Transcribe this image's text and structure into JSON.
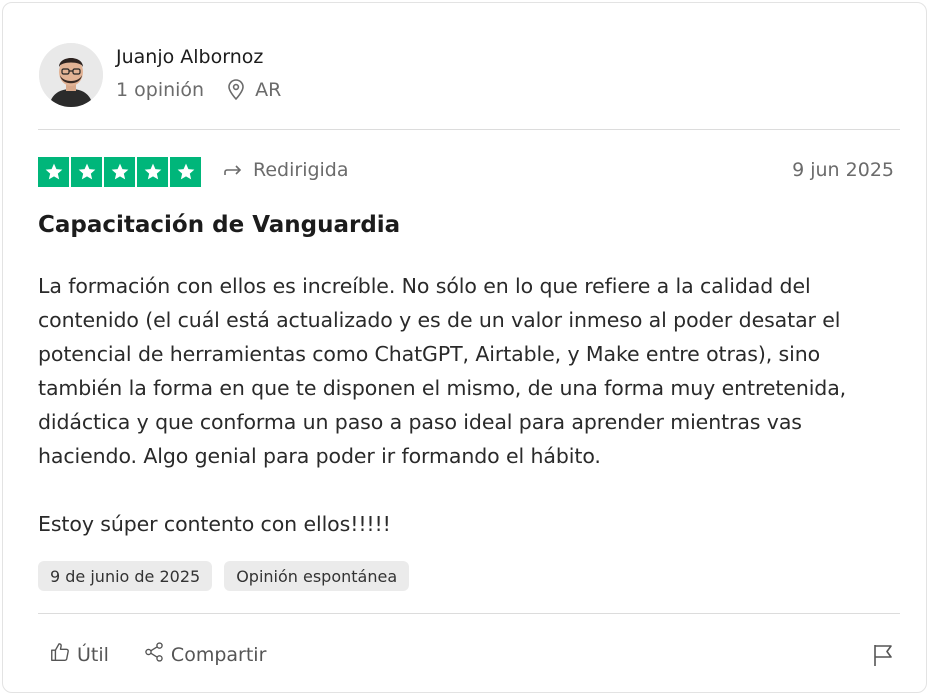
{
  "reviewer": {
    "name": "Juanjo Albornoz",
    "reviews_count": "1 opinión",
    "country": "AR"
  },
  "rating": {
    "stars": 5,
    "out_of": 5,
    "color": "#00b67a"
  },
  "status": {
    "label": "Redirigida"
  },
  "date_short": "9 jun 2025",
  "review": {
    "title": "Capacitación de Vanguardia",
    "body": "La formación con ellos es increíble. No sólo en lo que refiere a la calidad del\ncontenido (el cuál está actualizado y es de un valor inmeso al poder desatar el\npotencial de herramientas como ChatGPT, Airtable, y Make entre otras), sino\ntambién la forma en que te disponen el mismo, de una forma muy entretenida,\ndidáctica y que conforma un paso a paso ideal para aprender mientras vas\nhaciendo. Algo genial para poder ir formando el hábito.\n\nEstoy súper contento con ellos!!!!!"
  },
  "tags": [
    "9 de junio de 2025",
    "Opinión espontánea"
  ],
  "actions": {
    "useful_label": "Útil",
    "share_label": "Compartir"
  },
  "icons": {
    "location": "location-pin-icon",
    "redirect": "redirect-arrow-icon",
    "useful": "thumbs-up-icon",
    "share": "share-icon",
    "report": "flag-icon"
  }
}
